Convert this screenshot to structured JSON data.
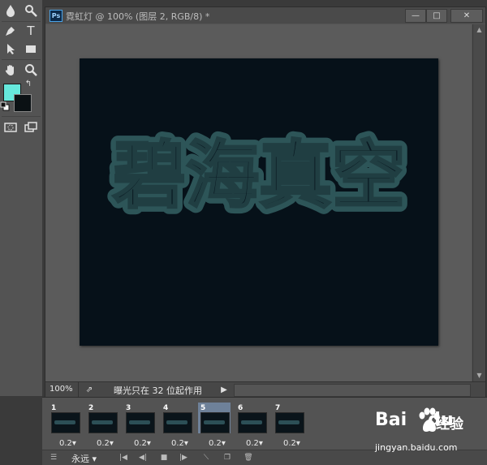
{
  "window": {
    "badge": "Ps",
    "title": "霓虹灯 @ 100% (图层 2, RGB/8) *",
    "min_glyph": "—",
    "max_glyph": "□",
    "close_glyph": "✕"
  },
  "tools": [
    "drop-icon",
    "zoom-icon",
    "pen-icon",
    "type-icon",
    "path-select-icon",
    "rectangle-icon",
    "hand-icon",
    "zoom-icon",
    "swap-colors-icon",
    "default-colors-icon",
    "quick-mask-icon",
    "screen-mode-icon"
  ],
  "tool_type_label": "T",
  "colors": {
    "foreground": "#66e8dc",
    "background": "#0b1114",
    "canvas": "#061119",
    "text_fill": "#0a1a22",
    "text_glow": "#2d5558"
  },
  "canvas": {
    "text": "碧海真空"
  },
  "status": {
    "zoom": "100%",
    "message": "曝光只在 32 位起作用"
  },
  "timeline": {
    "frames": [
      {
        "num": "1",
        "delay": "0.2▾"
      },
      {
        "num": "2",
        "delay": "0.2▾"
      },
      {
        "num": "3",
        "delay": "0.2▾"
      },
      {
        "num": "4",
        "delay": "0.2▾"
      },
      {
        "num": "5",
        "delay": "0.2▾"
      },
      {
        "num": "6",
        "delay": "0.2▾"
      },
      {
        "num": "7",
        "delay": "0.2▾"
      }
    ],
    "selected_index": 4,
    "loop": "永远 ▾"
  },
  "watermark": {
    "brand": "Bai",
    "brand_suffix": "du",
    "sub": "经验",
    "url": "jingyan.baidu.com"
  }
}
